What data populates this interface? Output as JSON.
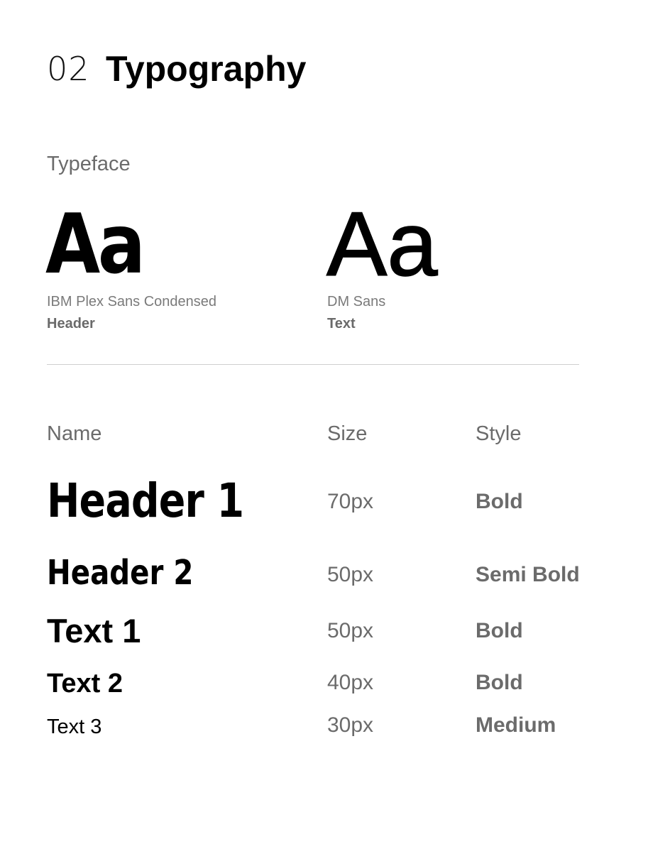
{
  "section": {
    "number": "02",
    "title": "Typography"
  },
  "typeface": {
    "label": "Typeface",
    "fonts": [
      {
        "specimen": "Aa",
        "name": "IBM Plex Sans Condensed",
        "role": "Header"
      },
      {
        "specimen": "Aa",
        "name": "DM Sans",
        "role": "Text"
      }
    ]
  },
  "table": {
    "headers": {
      "name": "Name",
      "size": "Size",
      "style": "Style"
    },
    "rows": [
      {
        "name": "Header 1",
        "size": "70px",
        "style": "Bold"
      },
      {
        "name": "Header 2",
        "size": "50px",
        "style": "Semi Bold"
      },
      {
        "name": "Text 1",
        "size": "50px",
        "style": "Bold"
      },
      {
        "name": "Text 2",
        "size": "40px",
        "style": "Bold"
      },
      {
        "name": "Text 3",
        "size": "30px",
        "style": "Medium"
      }
    ]
  }
}
